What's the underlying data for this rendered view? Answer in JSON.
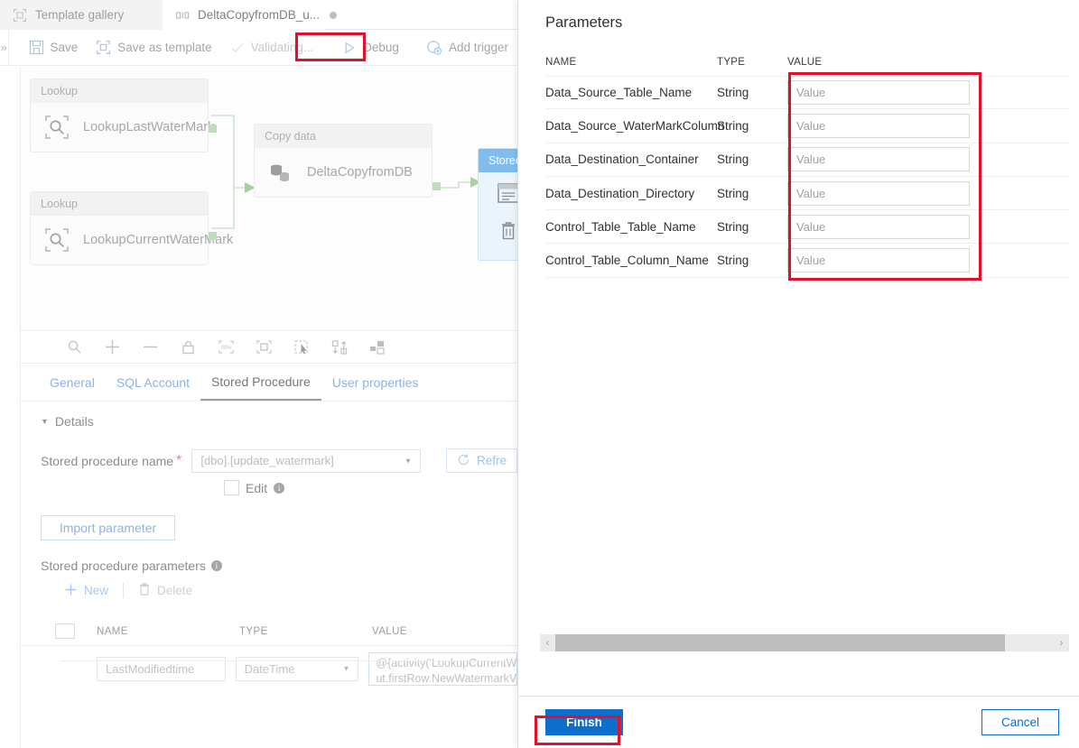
{
  "tabs": [
    {
      "label": "Template gallery",
      "icon": "template-gallery-icon",
      "active": false,
      "dirty": false
    },
    {
      "label": "DeltaCopyfromDB_u...",
      "icon": "pipeline-icon",
      "active": true,
      "dirty": true
    }
  ],
  "toolbar": {
    "expand_label": "»",
    "save_label": "Save",
    "save_as_template_label": "Save as template",
    "validating_label": "Validating...",
    "debug_label": "Debug",
    "add_trigger_label": "Add trigger"
  },
  "canvas": {
    "nodes": [
      {
        "type": "Lookup",
        "name": "LookupLastWaterMark",
        "icon": "lookup-icon"
      },
      {
        "type": "Lookup",
        "name": "LookupCurrentWaterMark",
        "icon": "lookup-icon"
      },
      {
        "type": "Copy data",
        "name": "DeltaCopyfromDB",
        "icon": "copy-data-icon"
      },
      {
        "type": "Stored",
        "name": "",
        "icon": "stored-procedure-icon",
        "selected": true
      }
    ],
    "tools": [
      {
        "name": "zoom-icon",
        "label": "Zoom"
      },
      {
        "name": "zoom-in-icon",
        "label": "Zoom in"
      },
      {
        "name": "zoom-out-icon",
        "label": "Zoom out"
      },
      {
        "name": "lock-icon",
        "label": "Lock"
      },
      {
        "name": "zoom-100-icon",
        "label": "100%"
      },
      {
        "name": "zoom-to-fit-icon",
        "label": "Zoom to fit"
      },
      {
        "name": "select-icon",
        "label": "Select"
      },
      {
        "name": "auto-align-icon",
        "label": "Auto align"
      },
      {
        "name": "layout-icon",
        "label": "Layout"
      }
    ]
  },
  "property_tabs": [
    {
      "label": "General",
      "selected": false
    },
    {
      "label": "SQL Account",
      "selected": false
    },
    {
      "label": "Stored Procedure",
      "selected": true
    },
    {
      "label": "User properties",
      "selected": false
    }
  ],
  "details": {
    "section_title": "Details",
    "stored_procedure_name_label": "Stored procedure name",
    "required_mark": "*",
    "stored_procedure_name_value": "[dbo].[update_watermark]",
    "refresh_label": "Refre",
    "edit_label": "Edit",
    "import_parameter_label": "Import parameter",
    "stored_procedure_parameters_label": "Stored procedure parameters",
    "new_label": "New",
    "delete_label": "Delete",
    "grid": {
      "columns": [
        "NAME",
        "TYPE",
        "VALUE"
      ],
      "rows": [
        {
          "name": "LastModifiedtime",
          "type": "DateTime",
          "value_line1": "@{activity('LookupCurrentWaterM",
          "value_line2": "ut.firstRow.NewWatermarkValue}"
        }
      ]
    }
  },
  "panel": {
    "title": "Parameters",
    "columns": {
      "name": "NAME",
      "type": "TYPE",
      "value": "VALUE"
    },
    "rows": [
      {
        "name": "Data_Source_Table_Name",
        "type": "String",
        "value": "",
        "placeholder": "Value"
      },
      {
        "name": "Data_Source_WaterMarkColumn",
        "type": "String",
        "value": "",
        "placeholder": "Value"
      },
      {
        "name": "Data_Destination_Container",
        "type": "String",
        "value": "",
        "placeholder": "Value"
      },
      {
        "name": "Data_Destination_Directory",
        "type": "String",
        "value": "",
        "placeholder": "Value"
      },
      {
        "name": "Control_Table_Table_Name",
        "type": "String",
        "value": "",
        "placeholder": "Value"
      },
      {
        "name": "Control_Table_Column_Name",
        "type": "String",
        "value": "",
        "placeholder": "Value"
      }
    ],
    "scroll_left_label": "‹",
    "scroll_right_label": "›",
    "finish_label": "Finish",
    "cancel_label": "Cancel"
  },
  "colors": {
    "annotation_red": "#e3102b",
    "primary_blue": "#0d6ecd",
    "node_selected_blue": "#81bdec",
    "connector_green": "#bfdcbd"
  }
}
